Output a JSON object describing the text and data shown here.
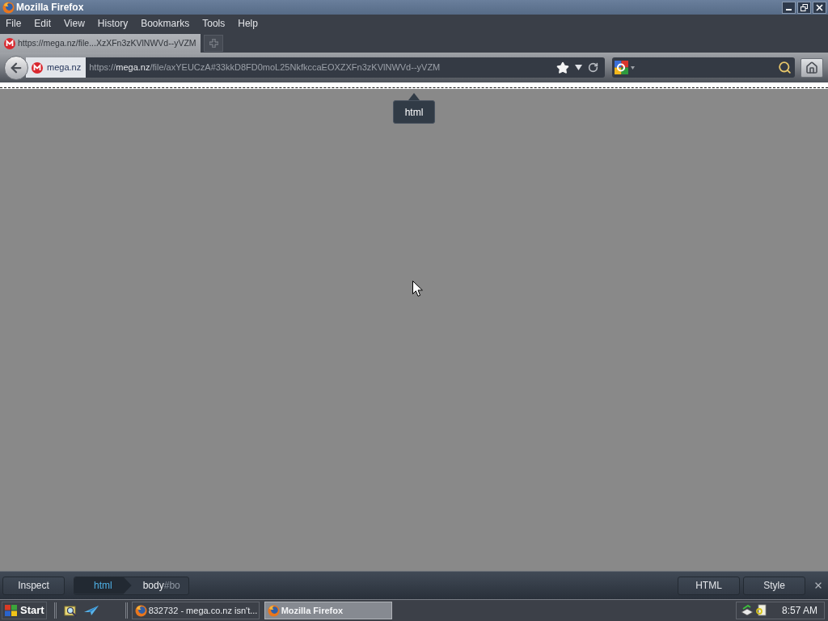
{
  "window": {
    "title": "Mozilla Firefox"
  },
  "menu": [
    "File",
    "Edit",
    "View",
    "History",
    "Bookmarks",
    "Tools",
    "Help"
  ],
  "tabs": [
    {
      "label": "https://mega.nz/file...XzXFn3zKVlNWVd--yVZM"
    }
  ],
  "nav": {
    "identity": "mega.nz",
    "url": {
      "scheme": "https://",
      "host": "mega.nz",
      "path": "/file/axYEUCzA#33kkD8FD0moL25NkfkccaEOXZXFn3zKVlNWVd--yVZM"
    }
  },
  "page": {
    "tooltip": "html"
  },
  "inspector": {
    "inspect_button": "Inspect",
    "breadcrumbs": [
      {
        "tag": "html",
        "selected": true
      },
      {
        "tag": "body",
        "id": "#bo",
        "selected": false
      }
    ],
    "panel_buttons": [
      "HTML",
      "Style"
    ]
  },
  "taskbar": {
    "start": "Start",
    "tasks": [
      {
        "label": "832732 - mega.co.nz isn't...",
        "selected": false
      },
      {
        "label": "Mozilla Firefox",
        "selected": true
      }
    ],
    "clock": "8:57 AM"
  }
}
